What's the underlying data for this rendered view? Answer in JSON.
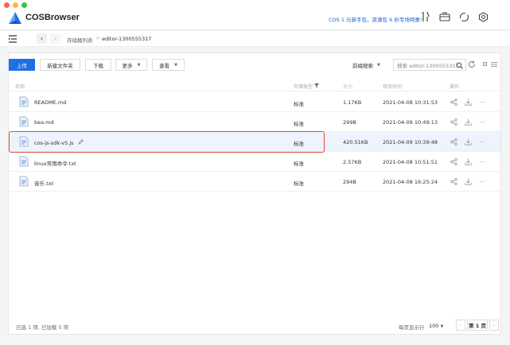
{
  "app": {
    "title": "COSBrowser",
    "promo": "COS 1 元新手包，资源包 6 折专场特惠!"
  },
  "colors": {
    "accent": "#1f6fe5",
    "highlight_border": "#e04a3c",
    "selected_row": "#eef3fd",
    "promo_text": "#1d5fd6"
  },
  "breadcrumb": {
    "items": [
      "存储桶列表",
      "editor-1300555317"
    ]
  },
  "toolbar": {
    "upload": "上传",
    "new_folder": "新建文件夹",
    "download": "下载",
    "more": "更多",
    "view": "查看",
    "search_scope": "前缀搜索",
    "search_placeholder": "搜索 editor-1300555317"
  },
  "table": {
    "headers": {
      "name": "名称",
      "storage": "存储类型",
      "size": "大小",
      "modified": "修改时间",
      "ops": "操作"
    },
    "rows": [
      {
        "name": "README.md",
        "storage": "标准",
        "size": "1.17KB",
        "modified": "2021-04-08 10:31:53"
      },
      {
        "name": "bea.md",
        "storage": "标准",
        "size": "299B",
        "modified": "2021-04-09 10:49:13"
      },
      {
        "name": "cos-js-sdk-v5.js",
        "storage": "标准",
        "size": "420.51KB",
        "modified": "2021-04-09 10:39:48"
      },
      {
        "name": "linux常用命令.txt",
        "storage": "标准",
        "size": "2.57KB",
        "modified": "2021-04-08 10:51:51"
      },
      {
        "name": "音乐.txt",
        "storage": "标准",
        "size": "294B",
        "modified": "2021-04-08 16:25:24"
      }
    ]
  },
  "footer": {
    "selection": "已选 1 项, 已加载 5 项",
    "page_size_label": "每页显示行",
    "page_size": "100",
    "page": "第 1 页"
  }
}
